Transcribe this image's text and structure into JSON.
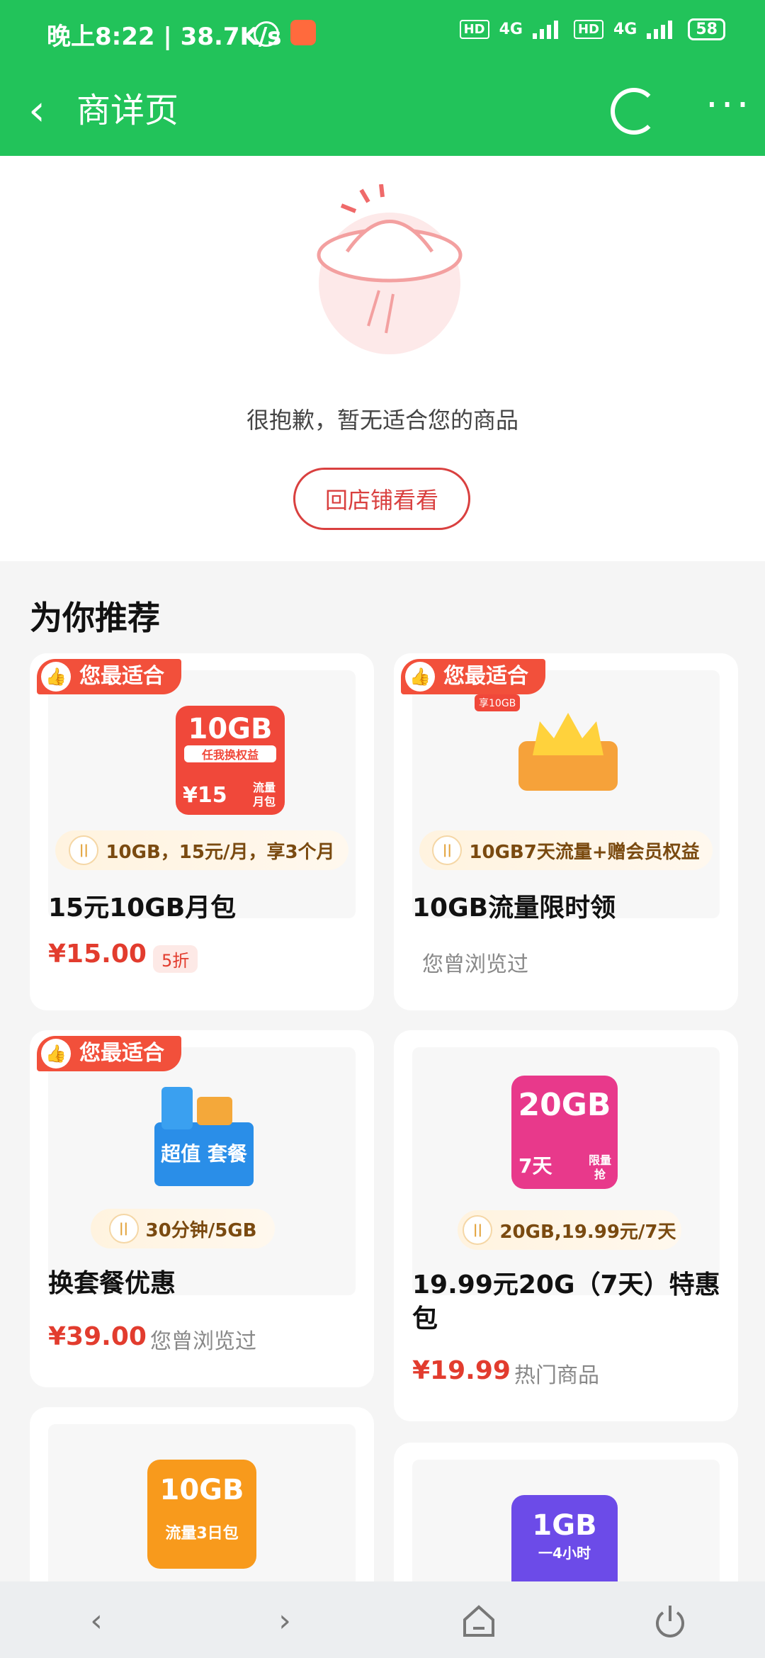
{
  "status": {
    "time": "晚上8:22 | 38.7K/s",
    "hd1": "HD",
    "net1": "4G",
    "hd2": "HD",
    "net2": "4G",
    "battery": "58"
  },
  "header": {
    "back_icon": "chevron-left-icon",
    "title": "商详页",
    "refresh_icon": "refresh-icon",
    "more_icon": "more-icon"
  },
  "empty_state": {
    "message": "很抱歉，暂无适合您的商品",
    "button_label": "回店铺看看"
  },
  "recommend": {
    "title": "为你推荐",
    "cards": [
      {
        "badge": "您最适合",
        "tag": "10GB，15元/月，享3个月",
        "name": "15元10GB月包",
        "price": "¥15.00",
        "discount": "5折",
        "image": {
          "big": "10GB",
          "mid": "任我换权益",
          "price": "¥15",
          "side": "流量月包"
        }
      },
      {
        "badge": "您最适合",
        "tag": "10GB7天流量+赠会员权益",
        "name": "10GB流量限时领",
        "sub": "您曾浏览过",
        "image": {
          "corner": "享10GB"
        }
      },
      {
        "badge": "您最适合",
        "tag": "30分钟/5GB",
        "name": "换套餐优惠",
        "price": "¥39.00",
        "sub": "您曾浏览过",
        "image": {
          "text": "超值 套餐"
        }
      },
      {
        "tag": "20GB,19.99元/7天",
        "name": "19.99元20G（7天）特惠包",
        "price": "¥19.99",
        "sub": "热门商品",
        "image": {
          "big": "20GB",
          "left": "7天",
          "right": "限量抢"
        }
      },
      {
        "image": {
          "big": "10GB",
          "sub": "流量3日包"
        }
      },
      {
        "image": {
          "big": "1GB",
          "sub": "一4小时"
        }
      }
    ]
  },
  "nav": {
    "back": "‹",
    "forward": "›",
    "home_icon": "home-icon",
    "power_icon": "power-icon"
  },
  "colors": {
    "accent_green": "#22c35a",
    "price_red": "#e23c2e",
    "badge_red": "#f2503b"
  }
}
